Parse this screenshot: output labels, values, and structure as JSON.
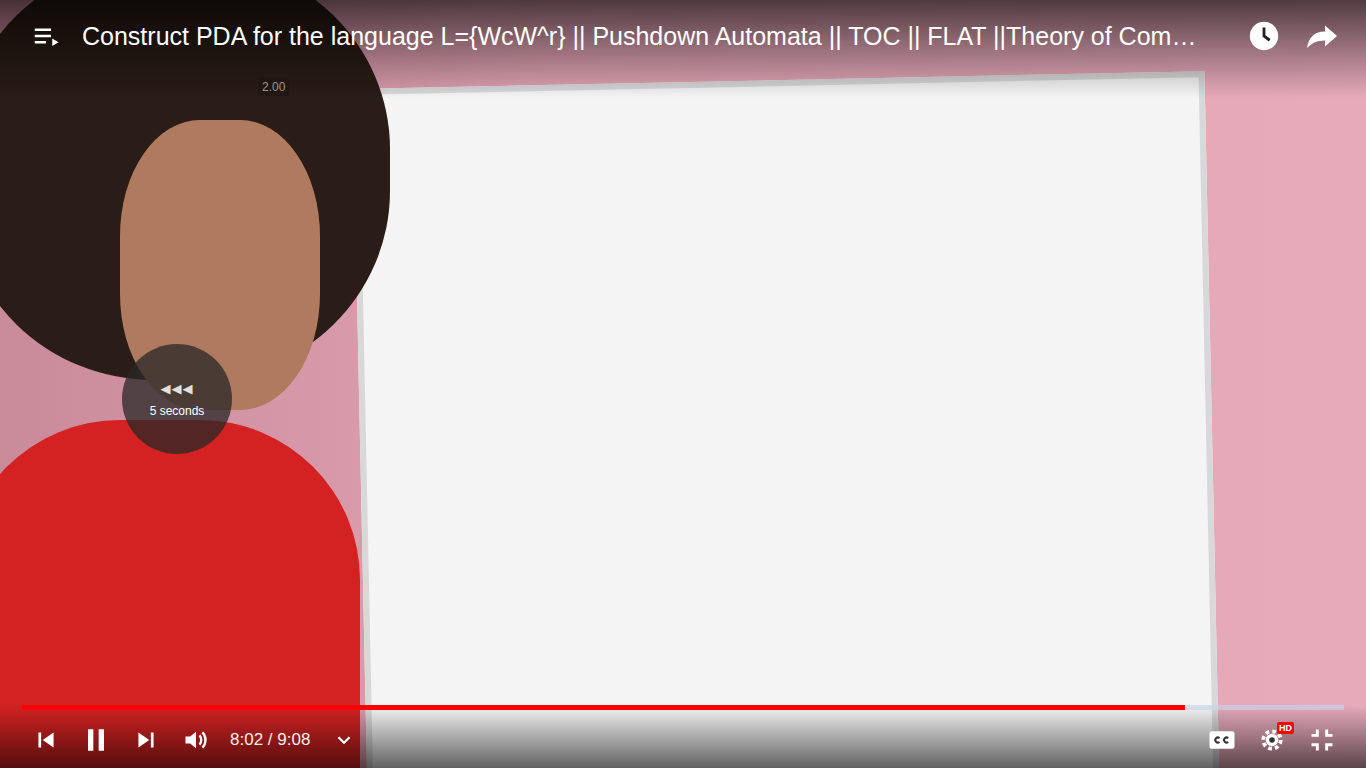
{
  "video": {
    "title": "Construct PDA for the language L={WcW^r} || Pushdown Automata || TOC || FLAT ||Theory of Com…",
    "speed_badge": "2.00"
  },
  "seek_indicator": {
    "arrows": "◀◀◀",
    "label": "5 seconds"
  },
  "progress": {
    "level": 0.88,
    "buffered": 1.0
  },
  "controls": {
    "playing": true,
    "time": "8:02 / 9:08",
    "hd_badge": "HD"
  }
}
